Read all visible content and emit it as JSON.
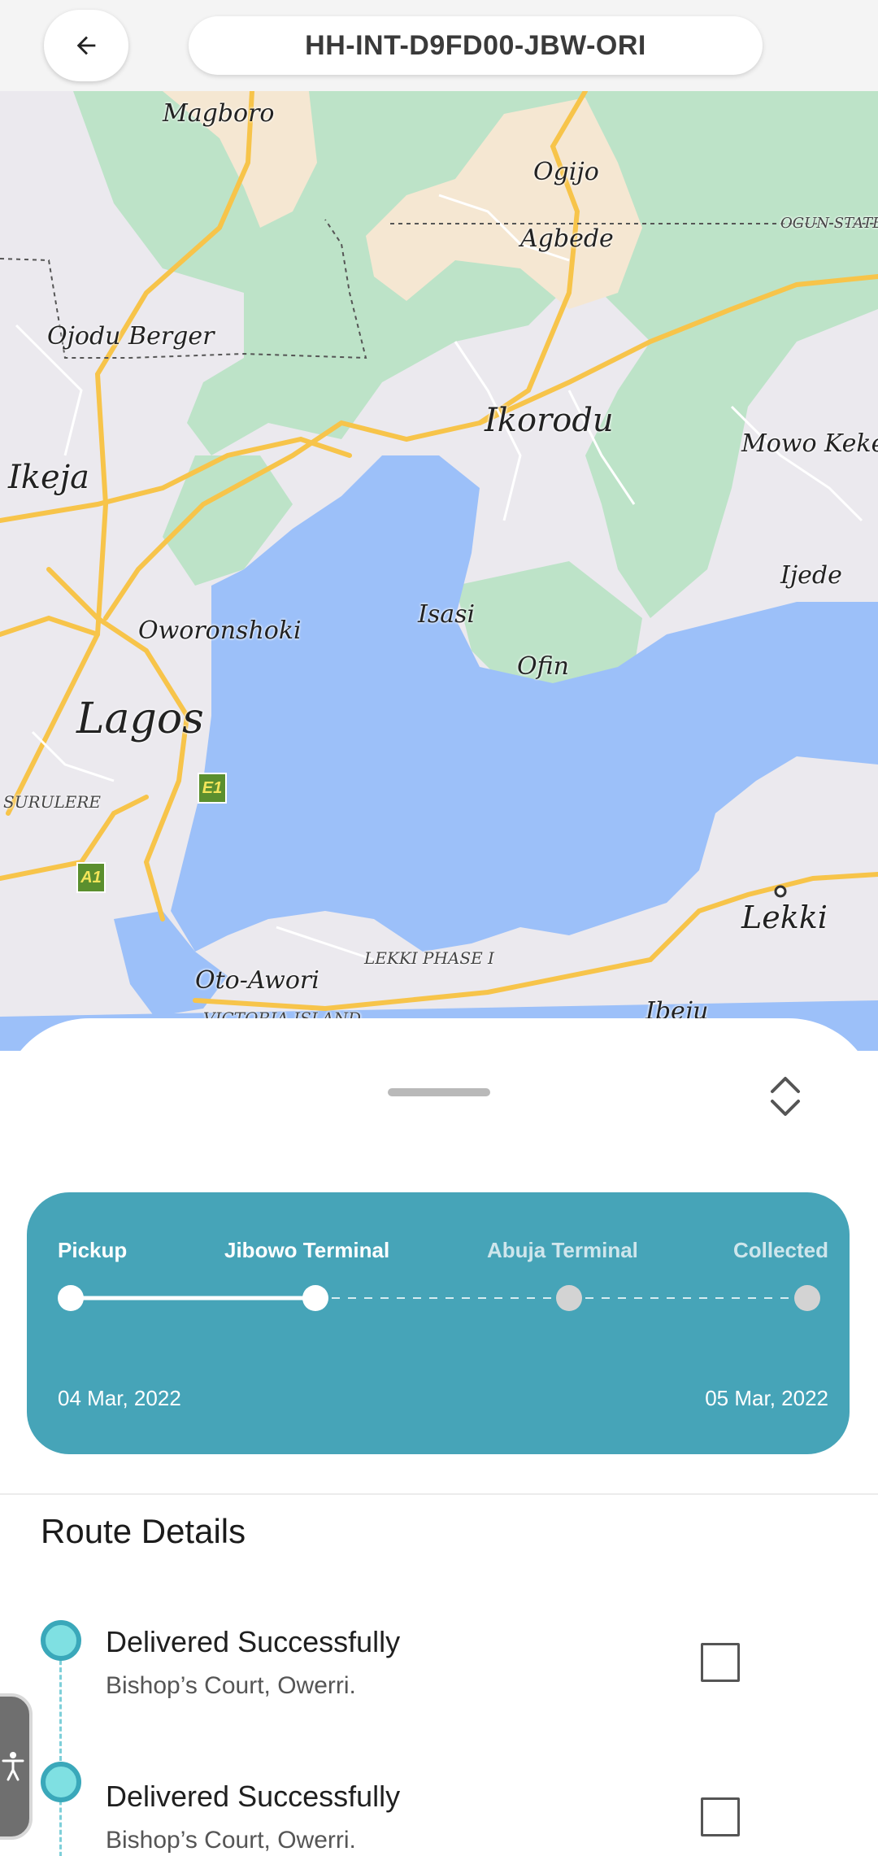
{
  "header": {
    "back_icon": "arrow-left-icon",
    "tracking_id": "HH-INT-D9FD00-JBW-ORI"
  },
  "map": {
    "labels": {
      "magboro": "Magboro",
      "ogijo": "Ogijo",
      "agbede": "Agbede",
      "ogun_state": "OGUN STATE",
      "ojodu_berger": "Ojodu Berger",
      "ikorodu": "Ikorodu",
      "mowo_kekere": "Mowo Kekere",
      "ikeja": "Ikeja",
      "ijede": "Ijede",
      "oworonshoki": "Oworonshoki",
      "isasi": "Isasi",
      "ofin": "Ofin",
      "lagos": "Lagos",
      "surulere": "SURULERE",
      "lekki": "Lekki",
      "lekki_phase_1": "LEKKI PHASE I",
      "oto_awori": "Oto-Awori",
      "victoria_island": "VICTORIA ISLAND",
      "ibeju": "Ibeju"
    },
    "shields": {
      "e1": "E1",
      "a1": "A1"
    },
    "colors": {
      "water": "#9cc0f9",
      "park": "#bde3c8",
      "urban": "#f5e7d2",
      "road": "#f7c44a",
      "land": "#ebe9ee"
    }
  },
  "sheet": {
    "expand_icon": "chevron-up-down-icon",
    "progress": {
      "accent": "#46a4b8",
      "stages": [
        {
          "label": "Pickup",
          "state": "done"
        },
        {
          "label": "Jibowo Terminal",
          "state": "current"
        },
        {
          "label": "Abuja Terminal",
          "state": "pending"
        },
        {
          "label": "Collected",
          "state": "pending"
        }
      ],
      "start_date": "04 Mar, 2022",
      "end_date": "05 Mar, 2022"
    },
    "route": {
      "title": "Route Details",
      "items": [
        {
          "status": "Delivered Successfully",
          "place": "Bishop’s Court, Owerri.",
          "checked": false
        },
        {
          "status": "Delivered Successfully",
          "place": "Bishop’s Court, Owerri.",
          "checked": false
        }
      ]
    },
    "accessibility_icon": "accessibility-icon"
  }
}
